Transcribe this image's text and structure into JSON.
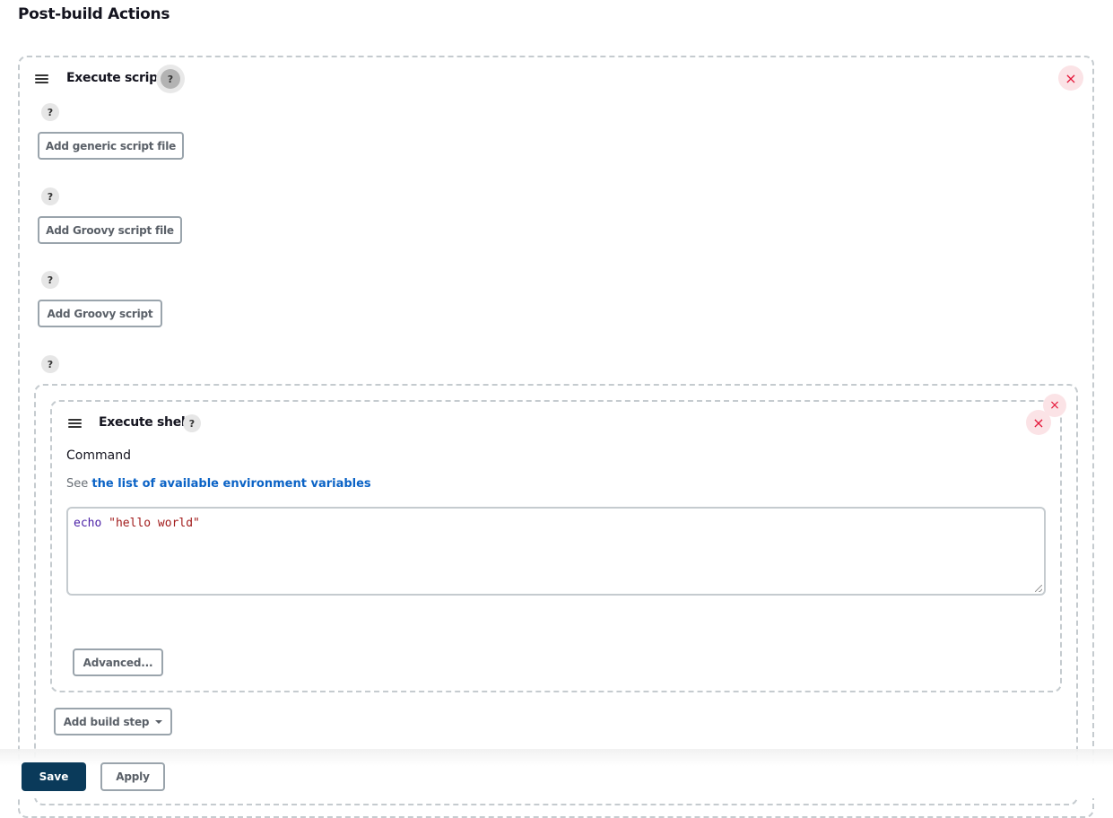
{
  "page": {
    "title": "Post-build Actions"
  },
  "execute_scripts": {
    "title": "Execute scripts",
    "help_icon": "question-icon",
    "close_icon": "close-icon",
    "buttons": [
      {
        "label": "Add generic script file"
      },
      {
        "label": "Add Groovy script file"
      },
      {
        "label": "Add Groovy script"
      }
    ],
    "help_mark": "?"
  },
  "execute_shell": {
    "title": "Execute shell",
    "command_label": "Command",
    "hint_prefix": "See",
    "hint_link": "the list of available environment variables",
    "command_keyword": "echo",
    "command_string": "\"hello world\"",
    "advanced_label": "Advanced..."
  },
  "add_build_step": {
    "label": "Add build step"
  },
  "footer": {
    "save_label": "Save",
    "apply_label": "Apply"
  },
  "icons": {
    "close": "×",
    "help": "?"
  }
}
